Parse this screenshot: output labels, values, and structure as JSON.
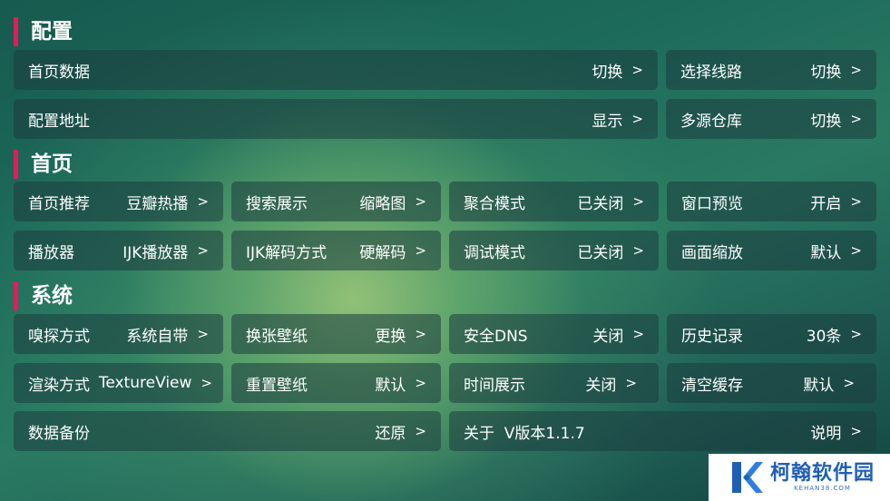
{
  "sections": {
    "config": "配置",
    "home": "首页",
    "system": "系统"
  },
  "arrow": ">",
  "config": {
    "home_data": {
      "label": "首页数据",
      "value": "切换"
    },
    "select_line": {
      "label": "选择线路",
      "value": "切换"
    },
    "config_url": {
      "label": "配置地址",
      "value": "显示"
    },
    "multi_source": {
      "label": "多源仓库",
      "value": "切换"
    }
  },
  "home": {
    "recommend": {
      "label": "首页推荐",
      "value": "豆瓣热播"
    },
    "search_display": {
      "label": "搜索展示",
      "value": "缩略图"
    },
    "aggregate": {
      "label": "聚合模式",
      "value": "已关闭"
    },
    "window_preview": {
      "label": "窗口预览",
      "value": "开启"
    },
    "player": {
      "label": "播放器",
      "value": "IJK播放器"
    },
    "ijk_decode": {
      "label": "IJK解码方式",
      "value": "硬解码"
    },
    "debug": {
      "label": "调试模式",
      "value": "已关闭"
    },
    "scale": {
      "label": "画面缩放",
      "value": "默认"
    }
  },
  "system": {
    "sniff": {
      "label": "嗅探方式",
      "value": "系统自带"
    },
    "wallpaper": {
      "label": "换张壁纸",
      "value": "更换"
    },
    "dns": {
      "label": "安全DNS",
      "value": "关闭"
    },
    "history": {
      "label": "历史记录",
      "value": "30条"
    },
    "render": {
      "label": "渲染方式",
      "value": "TextureView"
    },
    "reset_wallpaper": {
      "label": "重置壁纸",
      "value": "默认"
    },
    "time_display": {
      "label": "时间展示",
      "value": "关闭"
    },
    "clear_cache": {
      "label": "清空缓存",
      "value": "默认"
    },
    "backup": {
      "label": "数据备份",
      "value": "还原"
    },
    "about": {
      "label": "关于  V版本1.1.7",
      "value": "说明"
    }
  },
  "watermark": {
    "title": "柯翰软件园",
    "url": "KEHAN38.COM",
    "logo_icon": "k-logo-icon",
    "brand_color": "#1f5fb5"
  }
}
